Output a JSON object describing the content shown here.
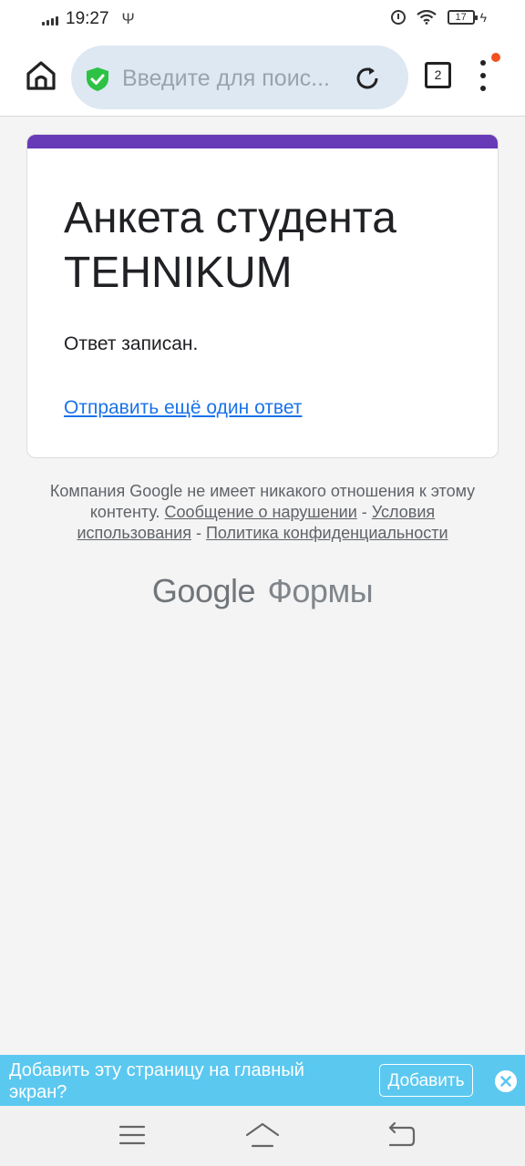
{
  "status_bar": {
    "time": "19:27",
    "usb_glyph": "Ψ",
    "battery_level": "17",
    "icons": [
      "signal-icon",
      "usb-icon",
      "alarm-icon",
      "wifi-icon",
      "battery-icon",
      "charging-icon"
    ]
  },
  "browser": {
    "address_placeholder": "Введите для поис...",
    "tab_count": "2",
    "icons": [
      "home-icon",
      "shield-check-icon",
      "reload-icon",
      "tabs-icon",
      "more-vert-icon"
    ],
    "colors": {
      "shield": "#2ec245",
      "notification_dot": "#f4511e",
      "urlbar_bg": "#dde8f3"
    }
  },
  "form": {
    "title": "Анкета студента TEHNIKUM",
    "confirmation": "Ответ записан.",
    "another_response_link": "Отправить ещё один ответ",
    "colors": {
      "accent": "#673ab7",
      "link": "#1a73e8"
    }
  },
  "footer": {
    "disclaimer_text": "Компания Google не имеет никакого отношения к этому контенту.",
    "report_link": "Сообщение о нарушении",
    "separator": "-",
    "terms_link": "Условия использования",
    "privacy_link": "Политика конфиденциальности",
    "brand_main": "Google",
    "brand_sub": "Формы"
  },
  "banner": {
    "text": "Добавить эту страницу на главный экран?",
    "add_button": "Добавить",
    "icons": [
      "close-icon"
    ],
    "colors": {
      "background": "#5bc8f0"
    }
  },
  "system_nav": {
    "icons": [
      "menu-icon",
      "home-icon",
      "back-icon"
    ]
  }
}
